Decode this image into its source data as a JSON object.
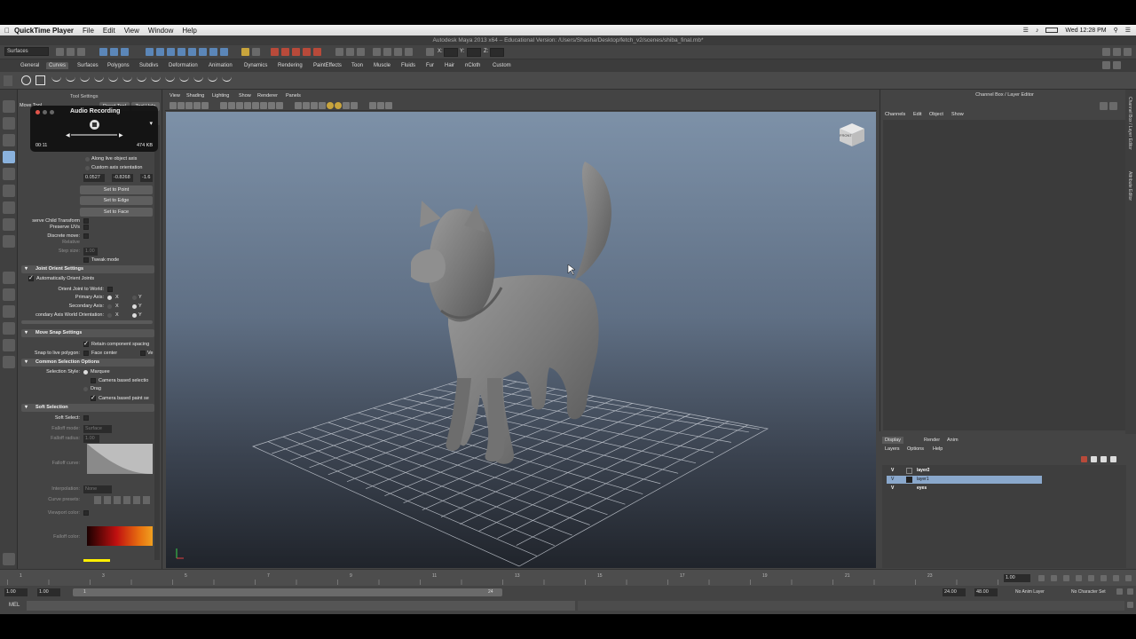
{
  "menubar": {
    "app_name": "QuickTime Player",
    "items": [
      "File",
      "Edit",
      "View",
      "Window",
      "Help"
    ],
    "clock": "Wed 12:28 PM"
  },
  "window": {
    "title": "Autodesk Maya 2013 x64 – Educational Version: /Users/Shasha/Desktop/fetch_v2/scenes/shiba_final.mb*"
  },
  "statusline": {
    "menuset": "Surfaces",
    "x_label": "X:",
    "y_label": "Y:",
    "z_label": "Z:"
  },
  "shelf": {
    "tabs": [
      "General",
      "Curves",
      "Surfaces",
      "Polygons",
      "Subdivs",
      "Deformation",
      "Animation",
      "Dynamics",
      "Rendering",
      "PaintEffects",
      "Toon",
      "Muscle",
      "Fluids",
      "Fur",
      "Hair",
      "nCloth",
      "Custom"
    ],
    "active_tab": "Curves"
  },
  "tool_settings": {
    "header": "Tool Settings",
    "tool_name": "Move Tool",
    "reset_tool": "Reset Tool",
    "tool_help": "Tool Help",
    "along_live_object_axis": "Along live object axis",
    "custom_axis_orientation": "Custom axis orientation",
    "axis_values": [
      "0.0527",
      "-0.8268",
      "-1.6"
    ],
    "set_to_point": "Set to Point",
    "set_to_edge": "Set to Edge",
    "set_to_face": "Set to Face",
    "preserve_child_transform": "serve Child Transform",
    "preserve_uvs": "Preserve UVs",
    "discrete_move": "Discrete move:",
    "relative": "Relative",
    "step_size": "Step size:",
    "step_size_value": "1.00",
    "tweak_mode": "Tweak mode",
    "joint_orient_settings": "Joint Orient Settings",
    "auto_orient_joints": "Automatically Orient Joints",
    "orient_joint_to_world": "Orient Joint to World:",
    "primary_axis": "Primary Axis:",
    "secondary_axis": "Secondary Axis:",
    "secondary_world": "condary Axis World Orientation:",
    "axis_x": "X",
    "axis_y": "Y",
    "move_snap_settings": "Move Snap Settings",
    "retain_component_spacing": "Retain component spacing",
    "snap_to_live_polygon": "Snap to live polygon:",
    "face_center": "Face center",
    "vertex_short": "Ve",
    "common_selection_options": "Common Selection Options",
    "selection_style": "Selection Style:",
    "marquee": "Marquee",
    "camera_based_selection": "Camera based selectio",
    "drag": "Drag",
    "camera_based_paint": "Camera based paint se",
    "soft_selection": "Soft Selection",
    "soft_select": "Soft Select:",
    "falloff_mode": "Falloff mode:",
    "falloff_mode_value": "Surface",
    "falloff_radius": "Falloff radius:",
    "falloff_radius_value": "1.00",
    "falloff_curve": "Falloff curve:",
    "interpolation": "Interpolation:",
    "interpolation_value": "None",
    "curve_presets": "Curve presets:",
    "viewport_color": "Viewport color:",
    "falloff_color": "Falloff color:"
  },
  "audio_recording": {
    "title": "Audio Recording",
    "time": "00:11",
    "size": "474 KB"
  },
  "viewport": {
    "menus": [
      "View",
      "Shading",
      "Lighting",
      "Show",
      "Renderer",
      "Panels"
    ],
    "viewcube_label": "FRONT"
  },
  "channel_box": {
    "title": "Channel Box / Layer Editor",
    "menus": [
      "Channels",
      "Edit",
      "Object",
      "Show"
    ]
  },
  "side_tabs": [
    "Channel Box / Layer Editor",
    "Attribute Editor"
  ],
  "layer_editor": {
    "tabs": [
      "Display",
      "Render",
      "Anim"
    ],
    "active_tab": "Display",
    "menus": [
      "Layers",
      "Options",
      "Help"
    ],
    "layers": [
      {
        "v": "V",
        "name": "layer2",
        "selected": false
      },
      {
        "v": "V",
        "name": "layer1",
        "selected": true
      },
      {
        "v": "V",
        "name": "eyes",
        "selected": false
      }
    ]
  },
  "timeline": {
    "ticks": [
      "1",
      "3",
      "5",
      "7",
      "9",
      "11",
      "13",
      "15",
      "17",
      "19",
      "21",
      "23"
    ],
    "current_frame": "1.00",
    "range_start": "1.00",
    "playback_start": "1.00",
    "range_marker_start": "1",
    "range_marker_end": "24",
    "playback_end": "24.00",
    "range_end": "48.00",
    "anim_layer": "No Anim Layer",
    "character_set": "No Character Set"
  },
  "command_line": {
    "label": "MEL"
  }
}
